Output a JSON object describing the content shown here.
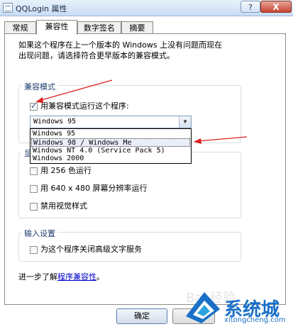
{
  "window": {
    "title": "QQLogin 属性",
    "help_label": "?",
    "close_label": "X"
  },
  "tabs": [
    {
      "label": "常规",
      "active": false
    },
    {
      "label": "兼容性",
      "active": true
    },
    {
      "label": "数字签名",
      "active": false
    },
    {
      "label": "摘要",
      "active": false
    }
  ],
  "description": {
    "line1": "如果这个程序在上一个版本的 Windows 上没有问题而现在",
    "line2": "出现问题，请选择符合更早版本的兼容模式。"
  },
  "compat_mode": {
    "legend": "兼容模式",
    "checkbox_label": "用兼容模式运行这个程序:",
    "checked": true,
    "selected_value": "Windows 95",
    "options": [
      "Windows 95",
      "Windows 98 / Windows Me",
      "Windows NT 4.0 (Service Pack 5)",
      "Windows 2000"
    ],
    "highlighted_option": "Windows 98 / Windows Me"
  },
  "display_settings": {
    "legend_partial": "显",
    "items": [
      {
        "label": "用 256 色运行",
        "checked": false
      },
      {
        "label": "用 640 x 480 屏幕分辨率运行",
        "checked": false
      },
      {
        "label": "禁用视觉样式",
        "checked": false
      }
    ]
  },
  "input_settings": {
    "legend": "输入设置",
    "item_label": "为这个程序关闭高级文字服务",
    "checked": false
  },
  "learn_more": {
    "prefix": "进一步了解",
    "link_text": "程序兼容性",
    "suffix": "。"
  },
  "buttons": {
    "ok_label": "确定",
    "next_label": "取"
  },
  "watermark": {
    "brand": "系统城",
    "url": "xitongcheng.com",
    "baidu": "Bai 经验"
  },
  "colors": {
    "annotation_arrow": "#e02020",
    "link": "#0000cc",
    "brand_blue": "#1a6fc8"
  }
}
